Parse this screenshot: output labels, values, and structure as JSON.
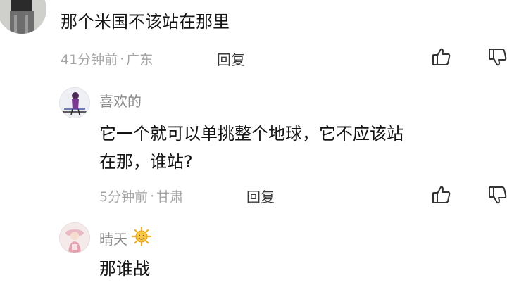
{
  "comments": [
    {
      "username": "",
      "text": "那个米国不该站在那里",
      "time": "41分钟前",
      "separator": "·",
      "location": "广东",
      "reply_label": "回复",
      "like_icon": "thumbs-up-icon",
      "dislike_icon": "thumbs-down-icon"
    },
    {
      "username": "喜欢的",
      "text_line1": "它一个就可以单挑整个地球，它不应该站",
      "text_line2": "在那，谁站?",
      "time": "5分钟前",
      "separator": "·",
      "location": "甘肃",
      "reply_label": "回复",
      "like_icon": "thumbs-up-icon",
      "dislike_icon": "thumbs-down-icon"
    },
    {
      "username": "晴天",
      "username_emoji": "sun-emoji-icon",
      "text": "那谁战"
    }
  ]
}
